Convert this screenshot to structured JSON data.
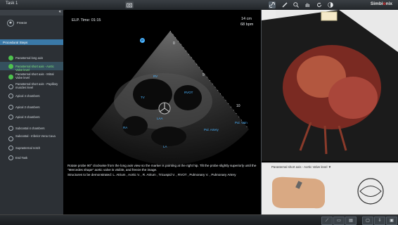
{
  "window": {
    "title": "Task 1",
    "brand_pre": "Simbi",
    "brand_accent": "o",
    "brand_post": "nix"
  },
  "toolbar_top": {
    "center_icon": "camera-icon",
    "right_icons": [
      "link-icon",
      "probe-icon",
      "zoom-in-icon",
      "hand-icon",
      "rotate-icon",
      "half-moon-icon"
    ]
  },
  "sidebar": {
    "collapse_glyph": "«",
    "freeze_label": "Freeze",
    "procedural_header": "Procedural Steps",
    "steps": [
      {
        "label": "Parasternal long axis",
        "state": "done"
      },
      {
        "label": "Parasternal short axis - Aortic Valve level",
        "state": "active"
      },
      {
        "label": "Parasternal short axis - Mitral Valve level",
        "state": "done"
      },
      {
        "label": "Parasternal short axis - Papillary muscles level",
        "state": "todo"
      },
      {
        "label": "Apical 4 chambers",
        "state": "todo"
      },
      {
        "label": "Apical 2 chambers",
        "state": "todo"
      },
      {
        "label": "Apical 3 chambers",
        "state": "todo"
      },
      {
        "label": "Subcostal 4 chambers",
        "state": "todo"
      },
      {
        "label": "Subcostal - Inferior Vena Cava",
        "state": "todo"
      },
      {
        "label": "Suprasternal notch",
        "state": "todo"
      },
      {
        "label": "End Task",
        "state": "todo"
      }
    ]
  },
  "echo": {
    "elapsed": "ELP. Time: 01:15",
    "depth": "14 cm",
    "heart_rate": "68 bpm",
    "depth_marks": [
      "0",
      "5",
      "10"
    ],
    "structure_labels": [
      "RV",
      "RVOT",
      "TV",
      "LAA",
      "RA",
      "LA",
      "Pul. Artery",
      "Pul. Vein"
    ],
    "orientation_marker": "P"
  },
  "instruction": {
    "line1": "Rotate probe 90° clockwise from the long axis view so the marker is pointing at the right hip. Tilt the probe slightly superiorly until the \"Mercedes shape\" aortic valve is visible, and freeze the image.",
    "line2": "Structures to be demonstrated: L. Atrium , Aortic V. , R. Atrium , Tricuspid V. , RVOT , Pulmonary V. , Pulmonary Artery"
  },
  "view_selector": {
    "label": "Parasternal short axis - Aortic Valve level",
    "dropdown_glyph": "▼"
  },
  "toolbar_bottom": {
    "icons": [
      "probe-tool-icon",
      "screen-record-icon",
      "lock-icon",
      "window-icon",
      "export-icon",
      "save-icon"
    ]
  },
  "colors": {
    "accent": "#3a79a8",
    "done": "#4ec24e",
    "active_text": "#7ee87e",
    "echo_label": "#4ab3ff"
  }
}
